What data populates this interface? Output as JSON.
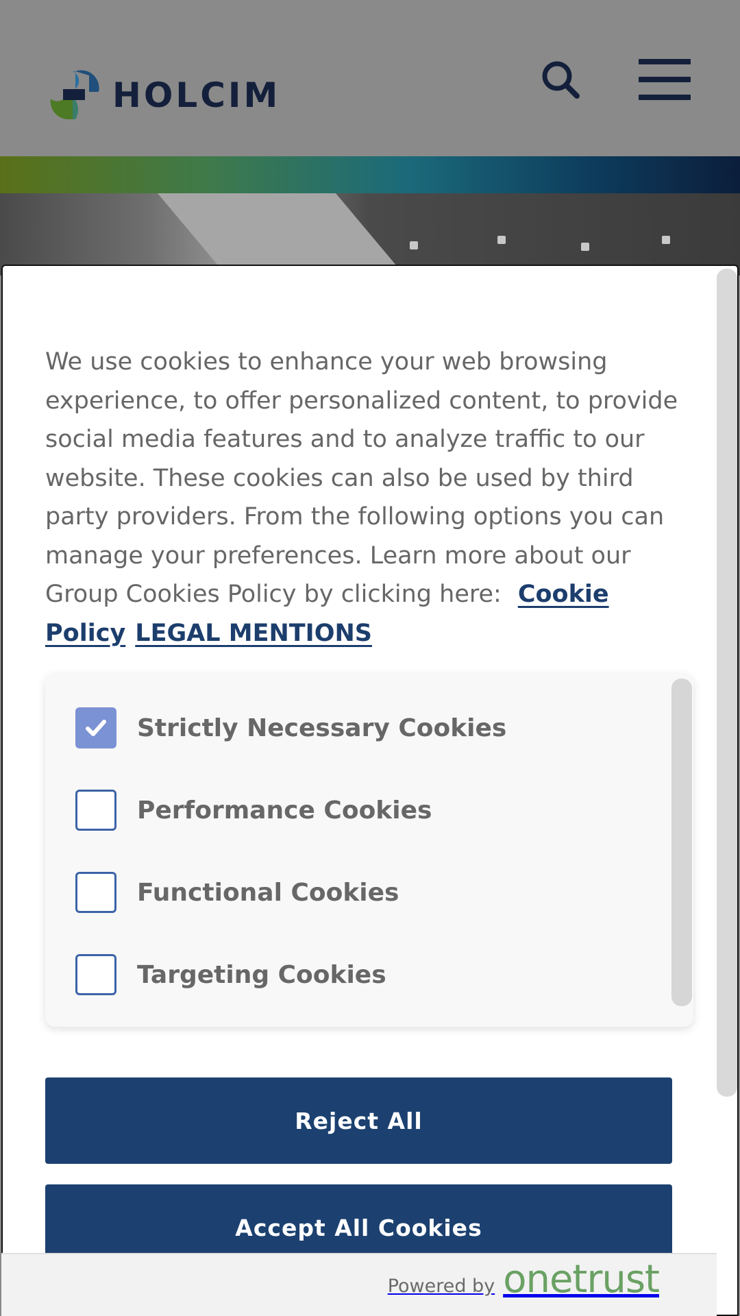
{
  "header": {
    "brand": "HOLCIM",
    "logo_icon": "holcim-logo-icon",
    "search_icon": "search-icon",
    "menu_icon": "hamburger-menu-icon"
  },
  "cookie_banner": {
    "description": "We use cookies to enhance your web browsing experience, to offer personalized content, to provide social media features and to analyze traffic to our website. These cookies can also be used by third party providers. From the following options you can manage your preferences. Learn more about our Group Cookies Policy by clicking here:",
    "links": {
      "cookie_policy": "Cookie Policy",
      "legal_mentions": "LEGAL MENTIONS"
    },
    "categories": [
      {
        "label": "Strictly Necessary Cookies",
        "checked": true
      },
      {
        "label": "Performance Cookies",
        "checked": false
      },
      {
        "label": "Functional Cookies",
        "checked": false
      },
      {
        "label": "Targeting Cookies",
        "checked": false
      }
    ],
    "buttons": {
      "reject_all": "Reject All",
      "accept_all": "Accept All Cookies"
    },
    "footer": {
      "powered_by": "Powered by",
      "brand": "onetrust"
    }
  },
  "colors": {
    "primary_button": "#1c4170",
    "link": "#1c3e6d",
    "checkbox_checked": "#7b92d4",
    "checkbox_border": "#3c63a6",
    "onetrust_green": "#6aa164",
    "overlay": "#8a8a8a"
  }
}
